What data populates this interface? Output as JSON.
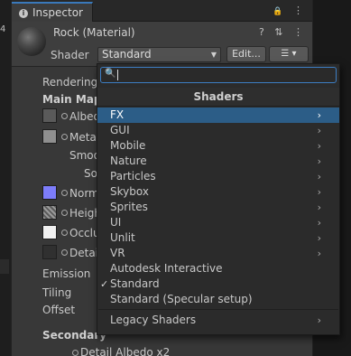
{
  "left_strip": {
    "number": "4"
  },
  "window": {
    "tab_label": "Inspector",
    "tab_tools": "⋮",
    "tab_lock": "🔒"
  },
  "header": {
    "material_name": "Rock (Material)",
    "icons": "? ⇅ ⋮",
    "shader_label": "Shader",
    "shader_value": "Standard",
    "edit_button": "Edit...",
    "list_button": "☰ ▾"
  },
  "properties": {
    "rendering": "Rendering",
    "main_maps": "Main Maps",
    "albedo": "Albedo",
    "metallic": "Meta",
    "smoothness": "Smoo",
    "source": "So",
    "normal": "Norm",
    "height": "Heigh",
    "occlusion": "Occlu",
    "detail": "Detai",
    "emission": "Emission",
    "tiling": "Tiling",
    "offset": "Offset",
    "secondary": "Secondary",
    "detail_albedo": "Detail Albedo x2"
  },
  "dropdown": {
    "search_value": "",
    "title": "Shaders",
    "items": [
      {
        "label": "FX",
        "submenu": true,
        "selected": true
      },
      {
        "label": "GUI",
        "submenu": true
      },
      {
        "label": "Mobile",
        "submenu": true
      },
      {
        "label": "Nature",
        "submenu": true
      },
      {
        "label": "Particles",
        "submenu": true
      },
      {
        "label": "Skybox",
        "submenu": true
      },
      {
        "label": "Sprites",
        "submenu": true
      },
      {
        "label": "UI",
        "submenu": true
      },
      {
        "label": "Unlit",
        "submenu": true
      },
      {
        "label": "VR",
        "submenu": true
      },
      {
        "label": "Autodesk Interactive",
        "submenu": false
      },
      {
        "label": "Standard",
        "submenu": false,
        "checked": true
      },
      {
        "label": "Standard (Specular setup)",
        "submenu": false
      }
    ],
    "legacy": "Legacy Shaders",
    "chevron": "›",
    "checkmark": "✓"
  },
  "colors": {
    "accent": "#2c5d87",
    "focus": "#3d7ec3",
    "normal_swatch": "#7d7dfa"
  }
}
